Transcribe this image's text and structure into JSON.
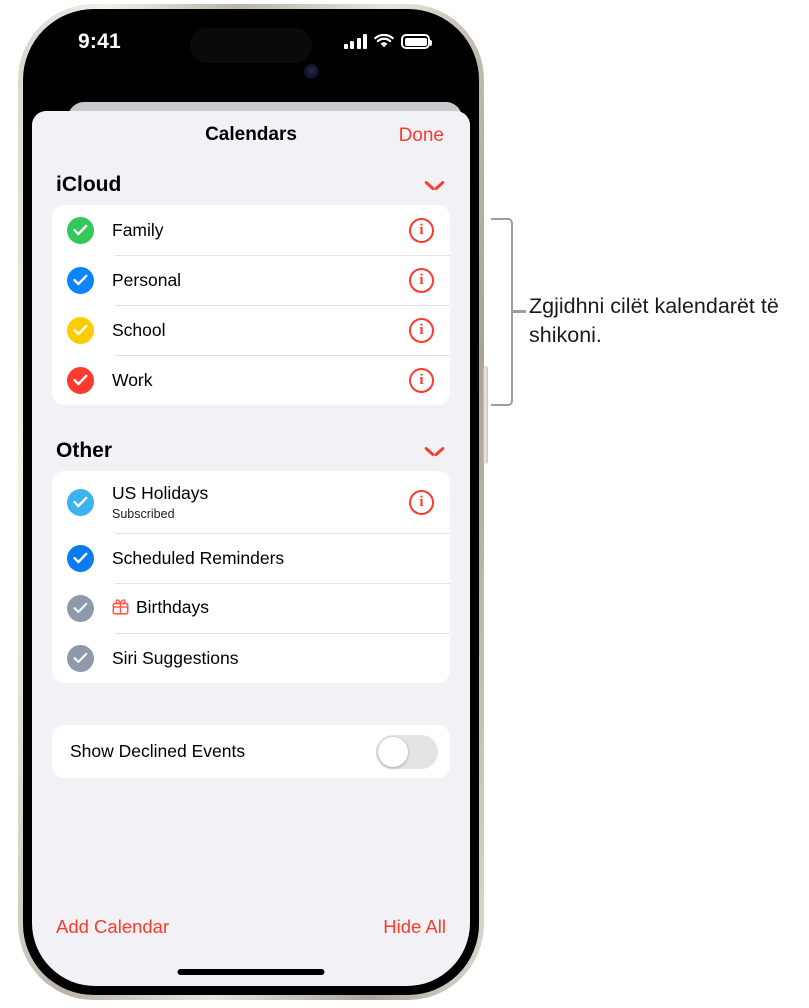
{
  "status_bar": {
    "time": "9:41",
    "cellular_icon": "signal-bars-icon",
    "wifi_icon": "wifi-icon",
    "battery_icon": "battery-icon"
  },
  "sheet": {
    "nav": {
      "title": "Calendars",
      "done_label": "Done"
    },
    "sections": [
      {
        "title": "iCloud",
        "chevron_icon": "chevron-down-icon",
        "rows": [
          {
            "label": "Family",
            "subtitle": "",
            "color": "#34c759",
            "checked": true,
            "info": true,
            "gift": false
          },
          {
            "label": "Personal",
            "subtitle": "",
            "color": "#0a84ff",
            "checked": true,
            "info": true,
            "gift": false
          },
          {
            "label": "School",
            "subtitle": "",
            "color": "#ffcc00",
            "checked": true,
            "info": true,
            "gift": false
          },
          {
            "label": "Work",
            "subtitle": "",
            "color": "#ff3b30",
            "checked": true,
            "info": true,
            "gift": false
          }
        ]
      },
      {
        "title": "Other",
        "chevron_icon": "chevron-down-icon",
        "rows": [
          {
            "label": "US Holidays",
            "subtitle": "Subscribed",
            "color": "#3bb3ef",
            "checked": true,
            "info": true,
            "gift": false
          },
          {
            "label": "Scheduled Reminders",
            "subtitle": "",
            "color": "#0a7cf0",
            "checked": true,
            "info": false,
            "gift": false
          },
          {
            "label": "Birthdays",
            "subtitle": "",
            "color": "#8e99ab",
            "checked": true,
            "info": false,
            "gift": true
          },
          {
            "label": "Siri Suggestions",
            "subtitle": "",
            "color": "#8e99ab",
            "checked": true,
            "info": false,
            "gift": false
          }
        ]
      }
    ],
    "toggle": {
      "label": "Show Declined Events",
      "on": false
    },
    "bottom": {
      "add_calendar_label": "Add Calendar",
      "hide_all_label": "Hide All"
    }
  },
  "callout": {
    "text": "Zgjidhni cilët kalendarët të shikoni."
  },
  "colors": {
    "accent_red": "#fc3b2d",
    "sheet_background": "#f2f1f6",
    "card_background": "#ffffff",
    "bracket_gray": "#9e9e9e"
  }
}
